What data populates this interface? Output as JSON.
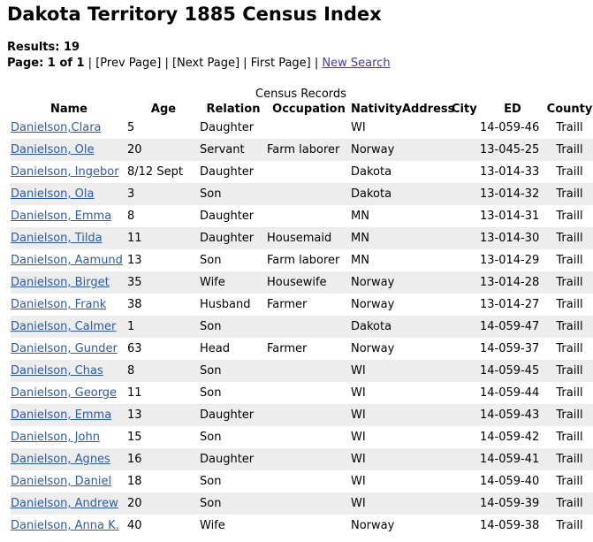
{
  "header": {
    "title": "Dakota Territory 1885 Census Index"
  },
  "results": {
    "label": "Results: 19"
  },
  "pagination": {
    "page_label": "Page: 1 of 1",
    "sep": "|",
    "prev_page": "[Prev Page]",
    "next_page": "[Next Page]",
    "first_page": "First Page]",
    "new_search": "New Search"
  },
  "table": {
    "caption": "Census Records",
    "columns": {
      "name": "Name",
      "age": "Age",
      "relation": "Relation",
      "occupation": "Occupation",
      "nativity": "Nativity",
      "address": "Address",
      "city": "City",
      "ed": "ED",
      "county": "County"
    },
    "rows": [
      {
        "name": "Danielson,Clara",
        "age": "5",
        "relation": "Daughter",
        "occupation": "",
        "nativity": "WI",
        "address": "",
        "city": "",
        "ed": "14-059-46",
        "county": "Traill"
      },
      {
        "name": "Danielson, Ole",
        "age": "20",
        "relation": "Servant",
        "occupation": "Farm laborer",
        "nativity": "Norway",
        "address": "",
        "city": "",
        "ed": "13-045-25",
        "county": "Traill"
      },
      {
        "name": "Danielson, Ingebor",
        "age": "8/12 Sept",
        "relation": "Daughter",
        "occupation": "",
        "nativity": "Dakota",
        "address": "",
        "city": "",
        "ed": "13-014-33",
        "county": "Traill"
      },
      {
        "name": "Danielson, Ola",
        "age": "3",
        "relation": "Son",
        "occupation": "",
        "nativity": "Dakota",
        "address": "",
        "city": "",
        "ed": "13-014-32",
        "county": "Traill"
      },
      {
        "name": "Danielson, Emma",
        "age": "8",
        "relation": "Daughter",
        "occupation": "",
        "nativity": "MN",
        "address": "",
        "city": "",
        "ed": "13-014-31",
        "county": "Traill"
      },
      {
        "name": "Danielson, Tilda",
        "age": "11",
        "relation": "Daughter",
        "occupation": "Housemaid",
        "nativity": "MN",
        "address": "",
        "city": "",
        "ed": "13-014-30",
        "county": "Traill"
      },
      {
        "name": "Danielson, Aamund",
        "age": "13",
        "relation": "Son",
        "occupation": "Farm laborer",
        "nativity": "MN",
        "address": "",
        "city": "",
        "ed": "13-014-29",
        "county": "Traill"
      },
      {
        "name": "Danielson, Birget",
        "age": "35",
        "relation": "Wife",
        "occupation": "Housewife",
        "nativity": "Norway",
        "address": "",
        "city": "",
        "ed": "13-014-28",
        "county": "Traill"
      },
      {
        "name": "Danielson, Frank",
        "age": "38",
        "relation": "Husband",
        "occupation": "Farmer",
        "nativity": "Norway",
        "address": "",
        "city": "",
        "ed": "13-014-27",
        "county": "Traill"
      },
      {
        "name": "Danielson, Calmer",
        "age": "1",
        "relation": "Son",
        "occupation": "",
        "nativity": "Dakota",
        "address": "",
        "city": "",
        "ed": "14-059-47",
        "county": "Traill"
      },
      {
        "name": "Danielson, Gunder",
        "age": "63",
        "relation": "Head",
        "occupation": "Farmer",
        "nativity": "Norway",
        "address": "",
        "city": "",
        "ed": "14-059-37",
        "county": "Traill"
      },
      {
        "name": "Danielson, Chas",
        "age": "8",
        "relation": "Son",
        "occupation": "",
        "nativity": "WI",
        "address": "",
        "city": "",
        "ed": "14-059-45",
        "county": "Traill"
      },
      {
        "name": "Danielson, George",
        "age": "11",
        "relation": "Son",
        "occupation": "",
        "nativity": "WI",
        "address": "",
        "city": "",
        "ed": "14-059-44",
        "county": "Traill"
      },
      {
        "name": "Danielson, Emma",
        "age": "13",
        "relation": "Daughter",
        "occupation": "",
        "nativity": "WI",
        "address": "",
        "city": "",
        "ed": "14-059-43",
        "county": "Traill"
      },
      {
        "name": "Danielson, John",
        "age": "15",
        "relation": "Son",
        "occupation": "",
        "nativity": "WI",
        "address": "",
        "city": "",
        "ed": "14-059-42",
        "county": "Traill"
      },
      {
        "name": "Danielson, Agnes",
        "age": "16",
        "relation": "Daughter",
        "occupation": "",
        "nativity": "WI",
        "address": "",
        "city": "",
        "ed": "14-059-41",
        "county": "Traill"
      },
      {
        "name": "Danielson, Daniel",
        "age": "18",
        "relation": "Son",
        "occupation": "",
        "nativity": "WI",
        "address": "",
        "city": "",
        "ed": "14-059-40",
        "county": "Traill"
      },
      {
        "name": "Danielson, Andrew",
        "age": "20",
        "relation": "Son",
        "occupation": "",
        "nativity": "WI",
        "address": "",
        "city": "",
        "ed": "14-059-39",
        "county": "Traill"
      },
      {
        "name": "Danielson, Anna K.",
        "age": "40",
        "relation": "Wife",
        "occupation": "",
        "nativity": "Norway",
        "address": "",
        "city": "",
        "ed": "14-059-38",
        "county": "Traill"
      }
    ]
  },
  "colors": {
    "link": "#2e5aa8",
    "visited_link": "#4b3a9a",
    "row_stripe": "#ededed"
  }
}
